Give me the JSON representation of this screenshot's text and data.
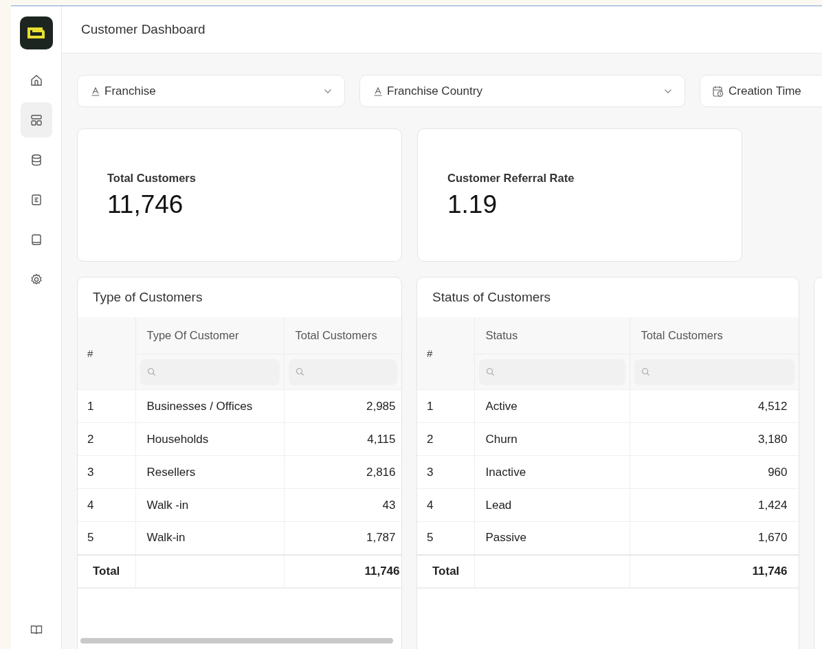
{
  "header": {
    "title": "Customer Dashboard"
  },
  "sidebar": {
    "items": [
      {
        "selected": false
      },
      {
        "selected": true
      },
      {
        "selected": false
      },
      {
        "selected": false
      },
      {
        "selected": false
      },
      {
        "selected": false
      }
    ]
  },
  "filters": [
    {
      "kind": "text",
      "label": "Franchise"
    },
    {
      "kind": "text",
      "label": "Franchise Country"
    },
    {
      "kind": "date",
      "label": "Creation Time"
    }
  ],
  "metrics": [
    {
      "label": "Total Customers",
      "value": "11,746"
    },
    {
      "label": "Customer Referral Rate",
      "value": "1.19"
    }
  ],
  "tables": [
    {
      "title": "Type of Customers",
      "columns": [
        "#",
        "Type Of Customer",
        "Total Customers"
      ],
      "rows": [
        [
          "1",
          "Businesses / Offices",
          "2,985"
        ],
        [
          "2",
          "Households",
          "4,115"
        ],
        [
          "3",
          "Resellers",
          "2,816"
        ],
        [
          "4",
          "Walk -in",
          "43"
        ],
        [
          "5",
          "Walk-in",
          "1,787"
        ]
      ],
      "total": {
        "label": "Total",
        "value": "11,746"
      },
      "scrolled": true
    },
    {
      "title": "Status of Customers",
      "columns": [
        "#",
        "Status",
        "Total Customers"
      ],
      "rows": [
        [
          "1",
          "Active",
          "4,512"
        ],
        [
          "2",
          "Churn",
          "3,180"
        ],
        [
          "3",
          "Inactive",
          "960"
        ],
        [
          "4",
          "Lead",
          "1,424"
        ],
        [
          "5",
          "Passive",
          "1,670"
        ]
      ],
      "total": {
        "label": "Total",
        "value": "11,746"
      },
      "scrolled": false
    }
  ]
}
